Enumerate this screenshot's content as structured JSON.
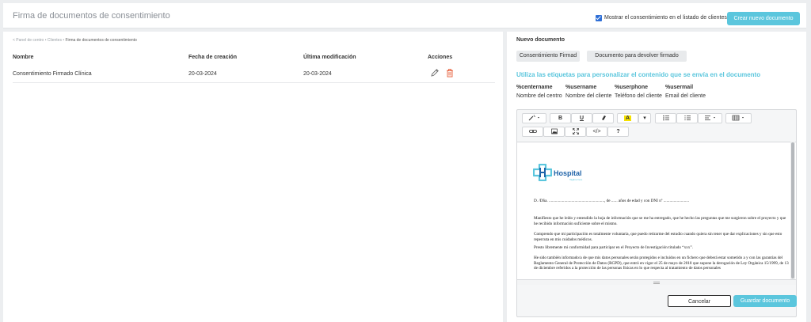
{
  "header": {
    "title": "Firma de documentos de consentimiento",
    "show_in_list_label": "Mostrar el consentimiento en el listado de clientes",
    "show_in_list_checked": true,
    "new_document_label": "Crear nuevo documento"
  },
  "breadcrumb": {
    "back": "< Panel de centro",
    "sep1": " • ",
    "clients": "Clientes",
    "sep2": " • ",
    "current": "Firma de documentos de consentimiento"
  },
  "table": {
    "columns": [
      "Nombre",
      "Fecha de creación",
      "Última modificación",
      "Acciones"
    ],
    "rows": [
      {
        "name": "Consentimiento Firmado Clínica",
        "created": "20-03-2024",
        "modified": "20-03-2024"
      }
    ]
  },
  "panel": {
    "title": "Nuevo documento",
    "tabs": [
      "Consentimiento Firmad",
      "Documento para devolver firmado"
    ],
    "tags_heading": "Utiliza las etiquetas para personalizar el contenido que se envía en el documento",
    "tags": [
      {
        "key": "%centername",
        "desc": "Nombre del centro"
      },
      {
        "key": "%username",
        "desc": "Nombre del cliente"
      },
      {
        "key": "%userphone",
        "desc": "Teléfono del cliente"
      },
      {
        "key": "%usermail",
        "desc": "Email del cliente"
      }
    ],
    "toolbar": {
      "bold": "B",
      "underline": "U",
      "highlight": "A",
      "code": "</>",
      "help": "?"
    },
    "cancel_label": "Cancelar",
    "save_label": "Guardar documento"
  },
  "document": {
    "logo_name": "Hospital",
    "logo_sub": "Tagline here",
    "line1": "D. /Dña. ......................................................, de ...... años de edad y con DNI nº .........................",
    "p1": "Manifiesto que he leído y entendido la hoja de información que se me ha entregado, que he hecho las preguntas que me surgieron sobre el proyecto y que he recibido información suficiente sobre el mismo.",
    "p2": "Comprendo que mi participación es totalmente voluntaria, que puedo retirarme del estudio cuando quiera sin tener que dar explicaciones y sin que esto repercuta en mis cuidados médicos.",
    "p3": "Presto libremente mi conformidad para participar en el Proyecto de Investigación titulado “xxx”.",
    "p4": "He sido también informado/a de que mis datos personales serán protegidos e incluidos en un fichero que deberá estar sometido a y con las garantías del Reglamento General de Protección de Datos (RGPD), que entró en vigor el 25 de mayo de 2018 que supone la derogación de Ley Orgánica 15/1999, de 13 de diciembre referidos a la protección de las personas físicas en lo que respecta al tratamiento de datos personales"
  },
  "colors": {
    "accent": "#5bc6dd",
    "danger": "#e8603c",
    "brand_blue": "#1f63a8"
  },
  "icons": [
    "edit-pencil-icon",
    "trash-icon",
    "magic-wand-icon",
    "eraser-icon",
    "list-ul-icon",
    "list-ol-icon",
    "align-icon",
    "table-icon",
    "link-icon",
    "image-icon",
    "fullscreen-icon"
  ]
}
